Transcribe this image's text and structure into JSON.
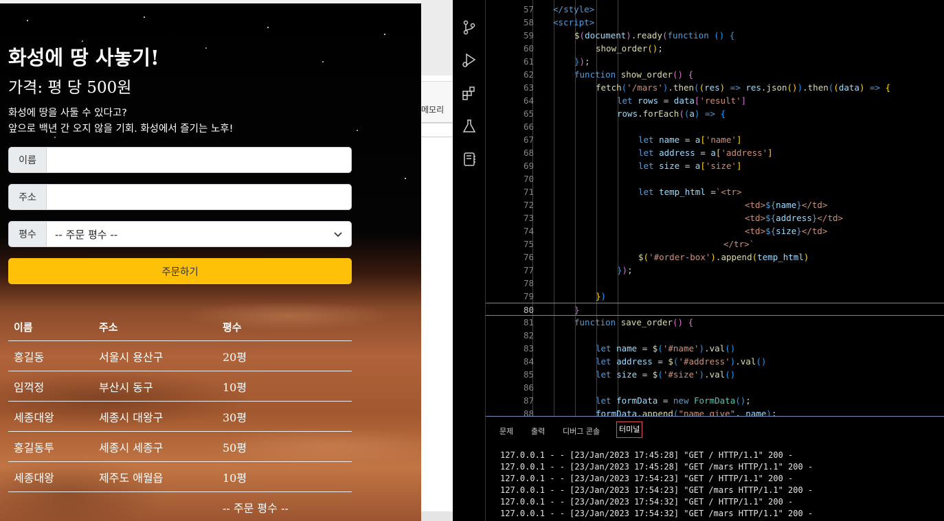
{
  "page": {
    "title": "화성에 땅 사놓기!",
    "price": "가격: 평 당 500원",
    "desc_line1": "화성에 땅을 사둘 수 있다고?",
    "desc_line2": "앞으로 백년 간 오지 않을 기회. 화성에서 즐기는 노후!",
    "form": {
      "name_label": "이름",
      "address_label": "주소",
      "size_label": "평수",
      "size_selected": "-- 주문 평수 --",
      "order_button": "주문하기"
    },
    "table": {
      "headers": [
        "이름",
        "주소",
        "평수"
      ],
      "rows": [
        [
          "홍길동",
          "서울시 용산구",
          "20평"
        ],
        [
          "임꺽정",
          "부산시 동구",
          "10평"
        ],
        [
          "세종대왕",
          "세종시 대왕구",
          "30평"
        ],
        [
          "홍길동투",
          "세종시 세종구",
          "50평"
        ],
        [
          "세종대왕",
          "제주도 애월읍",
          "10평"
        ]
      ],
      "extra_row_size": "-- 주문 평수 --"
    }
  },
  "background_window": {
    "memo_label": "메모리"
  },
  "activity_bar": {
    "icons": [
      "source-control-icon",
      "run-debug-icon",
      "extensions-icon",
      "testing-icon",
      "notebook-icon"
    ]
  },
  "editor": {
    "current_line": 80,
    "lines": [
      {
        "n": 57,
        "indent": 2,
        "tokens": [
          [
            "</",
            "tag"
          ],
          [
            "style",
            "tag"
          ],
          [
            ">",
            "tag"
          ]
        ]
      },
      {
        "n": 58,
        "indent": 2,
        "tokens": [
          [
            "<",
            "tag"
          ],
          [
            "script",
            "tag"
          ],
          [
            ">",
            "tag"
          ]
        ]
      },
      {
        "n": 59,
        "indent": 3,
        "tokens": [
          [
            "$",
            "fn"
          ],
          [
            "(",
            "br1"
          ],
          [
            "document",
            "var"
          ],
          [
            ")",
            "br1"
          ],
          [
            ".",
            "pun"
          ],
          [
            "ready",
            "fn"
          ],
          [
            "(",
            "br1"
          ],
          [
            "function",
            "kw"
          ],
          [
            " ",
            "pun"
          ],
          [
            "()",
            "br2"
          ],
          [
            " ",
            "pun"
          ],
          [
            "{",
            "br2"
          ]
        ]
      },
      {
        "n": 60,
        "indent": 4,
        "tokens": [
          [
            "show_order",
            "fn"
          ],
          [
            "()",
            "br3"
          ],
          [
            ";",
            "pun"
          ]
        ]
      },
      {
        "n": 61,
        "indent": 3,
        "tokens": [
          [
            "}",
            "br2"
          ],
          [
            ")",
            "br1"
          ],
          [
            ";",
            "pun"
          ]
        ]
      },
      {
        "n": 62,
        "indent": 3,
        "tokens": [
          [
            "function",
            "kw"
          ],
          [
            " ",
            "pun"
          ],
          [
            "show_order",
            "fn"
          ],
          [
            "()",
            "br1"
          ],
          [
            " ",
            "pun"
          ],
          [
            "{",
            "br1"
          ]
        ]
      },
      {
        "n": 63,
        "indent": 4,
        "tokens": [
          [
            "fetch",
            "fn"
          ],
          [
            "(",
            "br2"
          ],
          [
            "'/mars'",
            "str"
          ],
          [
            ")",
            "br2"
          ],
          [
            ".",
            "pun"
          ],
          [
            "then",
            "fn"
          ],
          [
            "(",
            "br2"
          ],
          [
            "(",
            "br3"
          ],
          [
            "res",
            "var"
          ],
          [
            ")",
            "br3"
          ],
          [
            " => ",
            "kw"
          ],
          [
            "res",
            "var"
          ],
          [
            ".",
            "pun"
          ],
          [
            "json",
            "fn"
          ],
          [
            "()",
            "br3"
          ],
          [
            ")",
            "br2"
          ],
          [
            ".",
            "pun"
          ],
          [
            "then",
            "fn"
          ],
          [
            "(",
            "br2"
          ],
          [
            "(",
            "br3"
          ],
          [
            "data",
            "var"
          ],
          [
            ")",
            "br3"
          ],
          [
            " => ",
            "kw"
          ],
          [
            "{",
            "br3"
          ]
        ]
      },
      {
        "n": 64,
        "indent": 5,
        "tokens": [
          [
            "let",
            "kw"
          ],
          [
            " ",
            "pun"
          ],
          [
            "rows",
            "var"
          ],
          [
            " = ",
            "pun"
          ],
          [
            "data",
            "var"
          ],
          [
            "[",
            "br1"
          ],
          [
            "'result'",
            "str"
          ],
          [
            "]",
            "br1"
          ]
        ]
      },
      {
        "n": 65,
        "indent": 5,
        "tokens": [
          [
            "rows",
            "var"
          ],
          [
            ".",
            "pun"
          ],
          [
            "forEach",
            "fn"
          ],
          [
            "(",
            "br1"
          ],
          [
            "(",
            "br2"
          ],
          [
            "a",
            "var"
          ],
          [
            ")",
            "br2"
          ],
          [
            " => ",
            "kw"
          ],
          [
            "{",
            "br2"
          ]
        ]
      },
      {
        "n": 66,
        "indent": 6,
        "tokens": []
      },
      {
        "n": 67,
        "indent": 6,
        "tokens": [
          [
            "let",
            "kw"
          ],
          [
            " ",
            "pun"
          ],
          [
            "name",
            "var"
          ],
          [
            " = ",
            "pun"
          ],
          [
            "a",
            "var"
          ],
          [
            "[",
            "br3"
          ],
          [
            "'name'",
            "str"
          ],
          [
            "]",
            "br3"
          ]
        ]
      },
      {
        "n": 68,
        "indent": 6,
        "tokens": [
          [
            "let",
            "kw"
          ],
          [
            " ",
            "pun"
          ],
          [
            "address",
            "var"
          ],
          [
            " = ",
            "pun"
          ],
          [
            "a",
            "var"
          ],
          [
            "[",
            "br3"
          ],
          [
            "'address'",
            "str"
          ],
          [
            "]",
            "br3"
          ]
        ]
      },
      {
        "n": 69,
        "indent": 6,
        "tokens": [
          [
            "let",
            "kw"
          ],
          [
            " ",
            "pun"
          ],
          [
            "size",
            "var"
          ],
          [
            " = ",
            "pun"
          ],
          [
            "a",
            "var"
          ],
          [
            "[",
            "br3"
          ],
          [
            "'size'",
            "str"
          ],
          [
            "]",
            "br3"
          ]
        ]
      },
      {
        "n": 70,
        "indent": 6,
        "tokens": []
      },
      {
        "n": 71,
        "indent": 6,
        "tokens": [
          [
            "let",
            "kw"
          ],
          [
            " ",
            "pun"
          ],
          [
            "temp_html",
            "var"
          ],
          [
            " =",
            "pun"
          ],
          [
            "`<tr>",
            "str"
          ]
        ]
      },
      {
        "n": 72,
        "indent": 11,
        "tokens": [
          [
            "<td>",
            "str"
          ],
          [
            "${",
            "kw"
          ],
          [
            "name",
            "var"
          ],
          [
            "}",
            "kw"
          ],
          [
            "</td>",
            "str"
          ]
        ]
      },
      {
        "n": 73,
        "indent": 11,
        "tokens": [
          [
            "<td>",
            "str"
          ],
          [
            "${",
            "kw"
          ],
          [
            "address",
            "var"
          ],
          [
            "}",
            "kw"
          ],
          [
            "</td>",
            "str"
          ]
        ]
      },
      {
        "n": 74,
        "indent": 11,
        "tokens": [
          [
            "<td>",
            "str"
          ],
          [
            "${",
            "kw"
          ],
          [
            "size",
            "var"
          ],
          [
            "}",
            "kw"
          ],
          [
            "</td>",
            "str"
          ]
        ]
      },
      {
        "n": 75,
        "indent": 10,
        "tokens": [
          [
            "</tr>`",
            "str"
          ]
        ]
      },
      {
        "n": 76,
        "indent": 6,
        "tokens": [
          [
            "$",
            "fn"
          ],
          [
            "(",
            "br3"
          ],
          [
            "'#order-box'",
            "str"
          ],
          [
            ")",
            "br3"
          ],
          [
            ".",
            "pun"
          ],
          [
            "append",
            "fn"
          ],
          [
            "(",
            "br3"
          ],
          [
            "temp_html",
            "var"
          ],
          [
            ")",
            "br3"
          ]
        ]
      },
      {
        "n": 77,
        "indent": 5,
        "tokens": [
          [
            "}",
            "br2"
          ],
          [
            ")",
            "br1"
          ],
          [
            ";",
            "pun"
          ]
        ]
      },
      {
        "n": 78,
        "indent": 5,
        "tokens": []
      },
      {
        "n": 79,
        "indent": 4,
        "tokens": [
          [
            "}",
            "br3"
          ],
          [
            ")",
            "br2"
          ]
        ]
      },
      {
        "n": 80,
        "indent": 3,
        "tokens": [
          [
            "}",
            "br1"
          ]
        ]
      },
      {
        "n": 81,
        "indent": 3,
        "tokens": [
          [
            "function",
            "kw"
          ],
          [
            " ",
            "pun"
          ],
          [
            "save_order",
            "fn"
          ],
          [
            "()",
            "br1"
          ],
          [
            " ",
            "pun"
          ],
          [
            "{",
            "br1"
          ]
        ]
      },
      {
        "n": 82,
        "indent": 4,
        "tokens": []
      },
      {
        "n": 83,
        "indent": 4,
        "tokens": [
          [
            "let",
            "kw"
          ],
          [
            " ",
            "pun"
          ],
          [
            "name",
            "var"
          ],
          [
            " = ",
            "pun"
          ],
          [
            "$",
            "fn"
          ],
          [
            "(",
            "br2"
          ],
          [
            "'#name'",
            "str"
          ],
          [
            ")",
            "br2"
          ],
          [
            ".",
            "pun"
          ],
          [
            "val",
            "fn"
          ],
          [
            "()",
            "br2"
          ]
        ]
      },
      {
        "n": 84,
        "indent": 4,
        "tokens": [
          [
            "let",
            "kw"
          ],
          [
            " ",
            "pun"
          ],
          [
            "address",
            "var"
          ],
          [
            " = ",
            "pun"
          ],
          [
            "$",
            "fn"
          ],
          [
            "(",
            "br2"
          ],
          [
            "'#address'",
            "str"
          ],
          [
            ")",
            "br2"
          ],
          [
            ".",
            "pun"
          ],
          [
            "val",
            "fn"
          ],
          [
            "()",
            "br2"
          ]
        ]
      },
      {
        "n": 85,
        "indent": 4,
        "tokens": [
          [
            "let",
            "kw"
          ],
          [
            " ",
            "pun"
          ],
          [
            "size",
            "var"
          ],
          [
            " = ",
            "pun"
          ],
          [
            "$",
            "fn"
          ],
          [
            "(",
            "br2"
          ],
          [
            "'#size'",
            "str"
          ],
          [
            ")",
            "br2"
          ],
          [
            ".",
            "pun"
          ],
          [
            "val",
            "fn"
          ],
          [
            "()",
            "br2"
          ]
        ]
      },
      {
        "n": 86,
        "indent": 4,
        "tokens": []
      },
      {
        "n": 87,
        "indent": 4,
        "tokens": [
          [
            "let",
            "kw"
          ],
          [
            " ",
            "pun"
          ],
          [
            "formData",
            "var"
          ],
          [
            " = ",
            "pun"
          ],
          [
            "new",
            "kw"
          ],
          [
            " ",
            "pun"
          ],
          [
            "FormData",
            "cls"
          ],
          [
            "()",
            "br2"
          ],
          [
            ";",
            "pun"
          ]
        ]
      },
      {
        "n": 88,
        "indent": 4,
        "tokens": [
          [
            "formData",
            "var"
          ],
          [
            ".",
            "pun"
          ],
          [
            "append",
            "fn"
          ],
          [
            "(",
            "br2"
          ],
          [
            "\"name_give\"",
            "str"
          ],
          [
            ", ",
            "pun"
          ],
          [
            "name",
            "var"
          ],
          [
            ")",
            "br2"
          ],
          [
            ";",
            "pun"
          ]
        ]
      }
    ]
  },
  "panel": {
    "tabs": [
      "문제",
      "출력",
      "디버그 콘솔",
      "터미널"
    ],
    "active_tab": "터미널",
    "logs": [
      "127.0.0.1 - - [23/Jan/2023 17:45:28] \"GET / HTTP/1.1\" 200 -",
      "127.0.0.1 - - [23/Jan/2023 17:45:28] \"GET /mars HTTP/1.1\" 200 -",
      "127.0.0.1 - - [23/Jan/2023 17:54:23] \"GET / HTTP/1.1\" 200 -",
      "127.0.0.1 - - [23/Jan/2023 17:54:23] \"GET /mars HTTP/1.1\" 200 -",
      "127.0.0.1 - - [23/Jan/2023 17:54:32] \"GET / HTTP/1.1\" 200 -",
      "127.0.0.1 - - [23/Jan/2023 17:54:32] \"GET /mars HTTP/1.1\" 200 -"
    ]
  },
  "colors": {
    "accent_button": "#ffc107",
    "current_line_border": "#c9733a",
    "panel_border": "#6c8fbf"
  }
}
